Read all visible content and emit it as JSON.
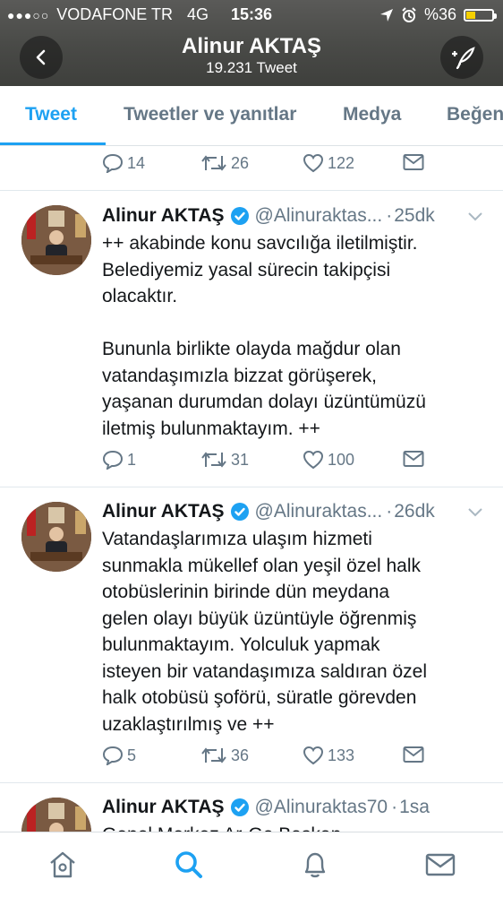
{
  "status_bar": {
    "signal": "●●●○○",
    "carrier": "VODAFONE TR",
    "network": "4G",
    "time": "15:36",
    "battery": "%36",
    "battery_level": 0.36
  },
  "header": {
    "title": "Alinur AKTAŞ",
    "subtitle": "19.231 Tweet"
  },
  "tabs": [
    "Tweet",
    "Tweetler ve yanıtlar",
    "Medya",
    "Beğen"
  ],
  "top_actions": {
    "replies": "14",
    "retweets": "26",
    "likes": "122"
  },
  "tweets": [
    {
      "name": "Alinur AKTAŞ",
      "handle": "@Alinuraktas...",
      "sep": "·",
      "time": "25dk",
      "lines": [
        "++ akabinde konu savcılığa iletilmiştir.",
        "Belediyemiz yasal sürecin takipçisi",
        "olacaktır.",
        "",
        "Bununla birlikte olayda mağdur olan",
        "vatandaşımızla bizzat görüşerek,",
        "yaşanan durumdan dolayı üzüntümüzü",
        "iletmiş bulunmaktayım. ++"
      ],
      "replies": "1",
      "retweets": "31",
      "likes": "100"
    },
    {
      "name": "Alinur AKTAŞ",
      "handle": "@Alinuraktas...",
      "sep": "·",
      "time": "26dk",
      "lines": [
        "Vatandaşlarımıza ulaşım hizmeti",
        "sunmakla mükellef olan yeşil özel halk",
        "otobüslerinin birinde dün meydana",
        "gelen olayı büyük üzüntüyle öğrenmiş",
        "bulunmaktayım. Yolculuk yapmak",
        "isteyen bir vatandaşımıza saldıran özel",
        "halk otobüsü şoförü, süratle görevden",
        "uzaklaştırılmış ve ++"
      ],
      "replies": "5",
      "retweets": "36",
      "likes": "133"
    },
    {
      "name": "Alinur AKTAŞ",
      "handle": "@Alinuraktas70",
      "sep": "·",
      "time": "1sa",
      "lines": [
        "Genel Merkez Ar-Ge Başkan..."
      ]
    }
  ],
  "colors": {
    "accent": "#1da1f2",
    "text": "#14171a",
    "secondary": "#657786",
    "header_bg": "#4a4b48",
    "battery": "#f5d000"
  },
  "icons": {
    "back": "chevron-left-icon",
    "compose": "compose-tweet-icon",
    "reply": "reply-icon",
    "retweet": "retweet-icon",
    "like": "heart-icon",
    "dm": "envelope-icon",
    "verified": "verified-badge-icon",
    "tabbar": [
      "home-icon",
      "search-icon",
      "notifications-icon",
      "messages-icon"
    ]
  }
}
